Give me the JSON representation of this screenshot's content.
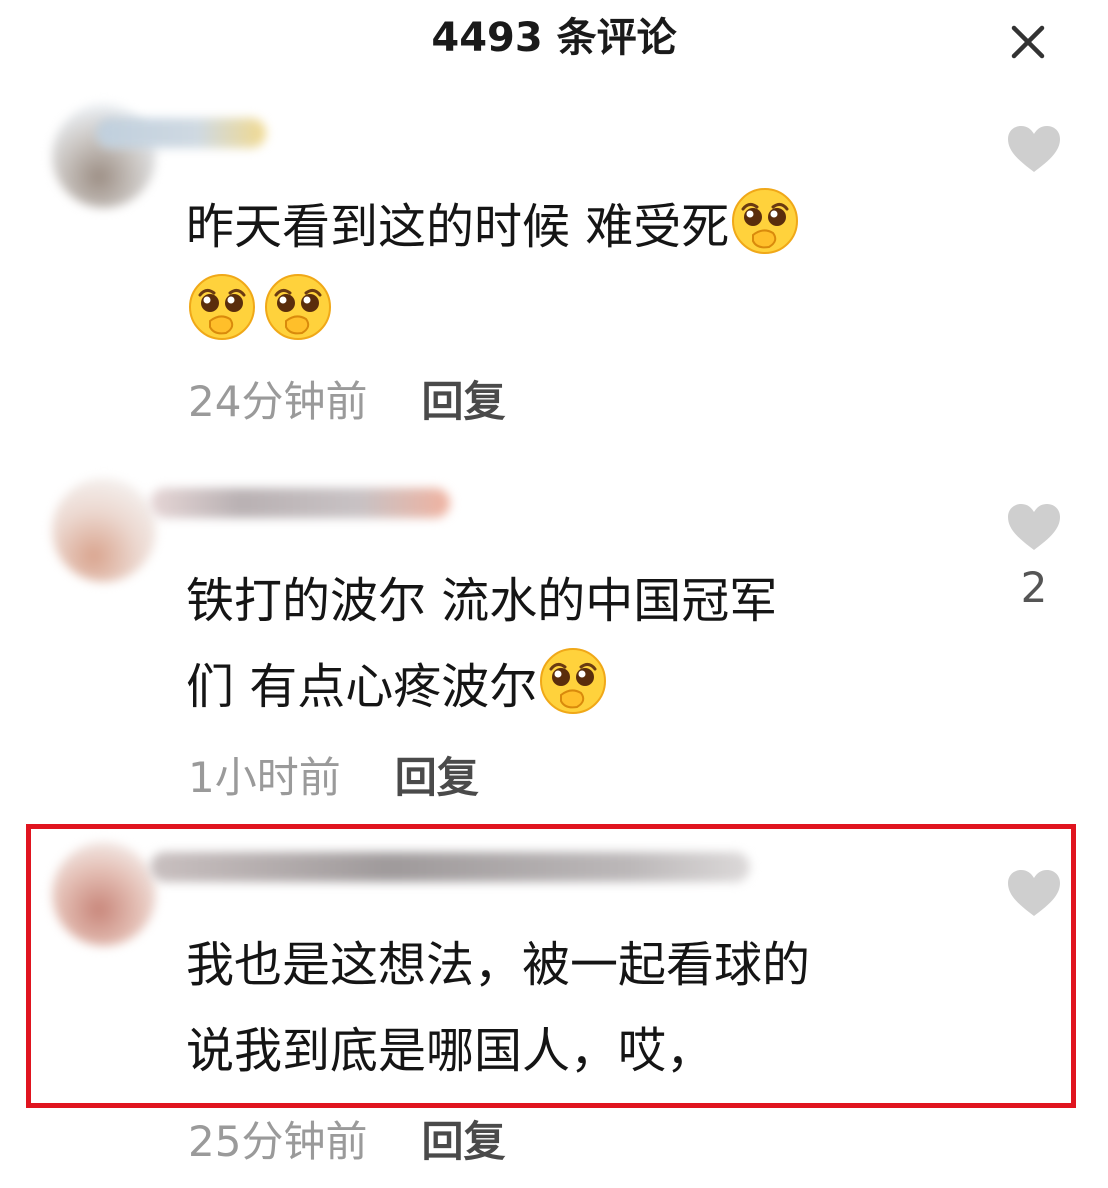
{
  "header": {
    "title": "4493 条评论",
    "close_icon": "close-icon"
  },
  "comments": [
    {
      "lines": [
        "昨天看到这的时候 难受死",
        ""
      ],
      "emoji_icon": "pleading-face-covering-mouth-icon",
      "timestamp": "24分钟前",
      "reply_label": "回复",
      "like_count": ""
    },
    {
      "lines": [
        "铁打的波尔 流水的中国冠军",
        "们 有点心疼波尔"
      ],
      "emoji_icon": "pleading-face-covering-mouth-icon",
      "timestamp": "1小时前",
      "reply_label": "回复",
      "like_count": "2"
    },
    {
      "lines": [
        "我也是这想法，被一起看球的",
        "说我到底是哪国人，哎，"
      ],
      "timestamp": "25分钟前",
      "reply_label": "回复",
      "like_count": "",
      "highlighted": true
    }
  ],
  "colors": {
    "highlight_border": "#e0141f",
    "timestamp": "#9a9a9a",
    "heart": "#cfcfcf"
  }
}
